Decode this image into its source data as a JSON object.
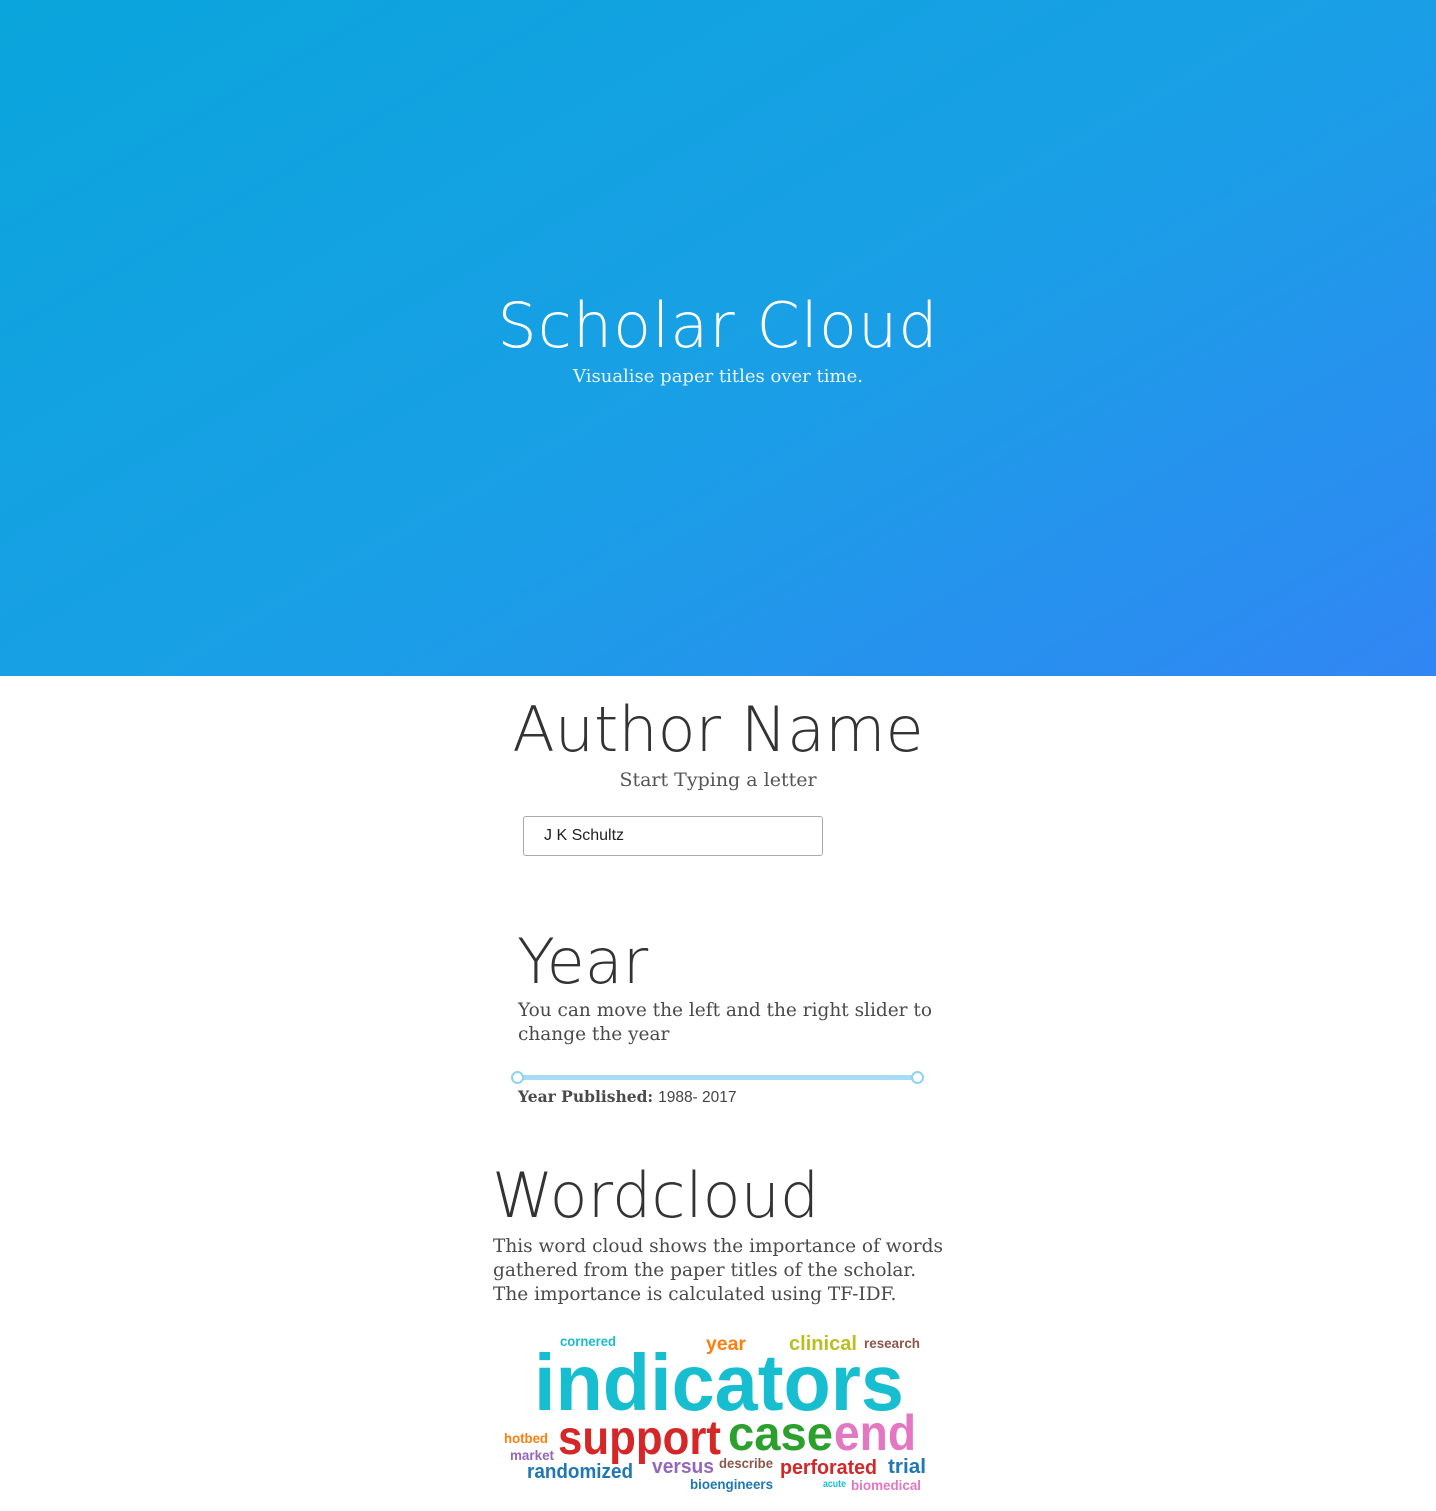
{
  "hero": {
    "title": "Scholar Cloud",
    "subtitle": "Visualise paper titles over time."
  },
  "author": {
    "heading": "Author Name",
    "hint": "Start Typing a letter",
    "input_value": "J K Schultz"
  },
  "year": {
    "heading": "Year",
    "description": "You can move the left and the right slider to change the year",
    "published_label": "Year Published:",
    "published_value": "1988- 2017",
    "range_start": 1988,
    "range_end": 2017
  },
  "wordcloud": {
    "heading": "Wordcloud",
    "description": "This word cloud shows the importance of words gathered from the paper titles of the scholar. The importance is calculated using TF-IDF.",
    "words": [
      {
        "text": "indicators",
        "color": "#17becf"
      },
      {
        "text": "support",
        "color": "#d62728"
      },
      {
        "text": "case",
        "color": "#2ca02c"
      },
      {
        "text": "end",
        "color": "#e377c2"
      },
      {
        "text": "clinical",
        "color": "#bcbd22"
      },
      {
        "text": "year",
        "color": "#ff7f0e"
      },
      {
        "text": "cornered",
        "color": "#17becf"
      },
      {
        "text": "research",
        "color": "#8c564b"
      },
      {
        "text": "hotbed",
        "color": "#ff7f0e"
      },
      {
        "text": "market",
        "color": "#9467bd"
      },
      {
        "text": "randomized",
        "color": "#1f77b4"
      },
      {
        "text": "versus",
        "color": "#9467bd"
      },
      {
        "text": "describe",
        "color": "#8c564b"
      },
      {
        "text": "perforated",
        "color": "#d62728"
      },
      {
        "text": "trial",
        "color": "#1f77b4"
      },
      {
        "text": "bioengineers",
        "color": "#1f77b4"
      },
      {
        "text": "acute",
        "color": "#17becf"
      },
      {
        "text": "biomedical",
        "color": "#e377c2"
      }
    ]
  }
}
